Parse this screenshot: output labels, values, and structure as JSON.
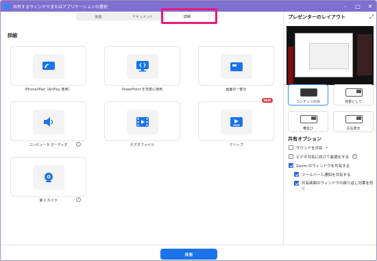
{
  "window": {
    "title": "共有するウィンドウまたはアプリケーションの選択"
  },
  "tabs": [
    {
      "label": "画面"
    },
    {
      "label": "ドキュメント"
    },
    {
      "label": "詳細"
    }
  ],
  "section_title": "詳細",
  "cards": [
    {
      "label": "iPhone/iPad（AirPlay 使用）",
      "icon": "airplay-icon",
      "info": false,
      "badge": ""
    },
    {
      "label": "PowerPoint を背景に使用",
      "icon": "powerpoint-background-icon",
      "info": false,
      "badge": ""
    },
    {
      "label": "画面の一部分",
      "icon": "screen-portion-icon",
      "info": false,
      "badge": ""
    },
    {
      "label": "コンピュータ オーディオ",
      "icon": "speaker-icon",
      "info": true,
      "badge": ""
    },
    {
      "label": "ビデオファイル",
      "icon": "video-file-icon",
      "info": false,
      "badge": ""
    },
    {
      "label": "クリップ",
      "icon": "clip-icon",
      "info": false,
      "badge": "NEW"
    },
    {
      "label": "第 2 カメラ",
      "icon": "webcam-icon",
      "info": true,
      "badge": ""
    }
  ],
  "right_panel": {
    "title": "プレゼンターのレイアウト",
    "layouts": [
      {
        "label": "コンテンツのみ",
        "selected": true
      },
      {
        "label": "背景として",
        "selected": false
      },
      {
        "label": "横並び",
        "selected": false
      },
      {
        "label": "左右表示",
        "selected": false
      }
    ],
    "options_title": "共有オプション",
    "options": [
      {
        "label": "サウンドを共有",
        "checked": false,
        "dropdown": true
      },
      {
        "label": "ビデオ共有に向けて最適化する",
        "checked": false,
        "info": true
      },
      {
        "label": "Zoom のウィンドウを共有する",
        "checked": true
      },
      {
        "label": "ツールバーと通知を共有する",
        "checked": true
      },
      {
        "label": "共有画面のウィンドウの繰り返し効果を防ぐ",
        "checked": true
      }
    ]
  },
  "footer": {
    "share_label": "共有"
  },
  "colors": {
    "accent": "#1a73e8",
    "titlebar": "#7f6fd1",
    "highlight": "#e8197a",
    "badge": "#d33a3a"
  }
}
